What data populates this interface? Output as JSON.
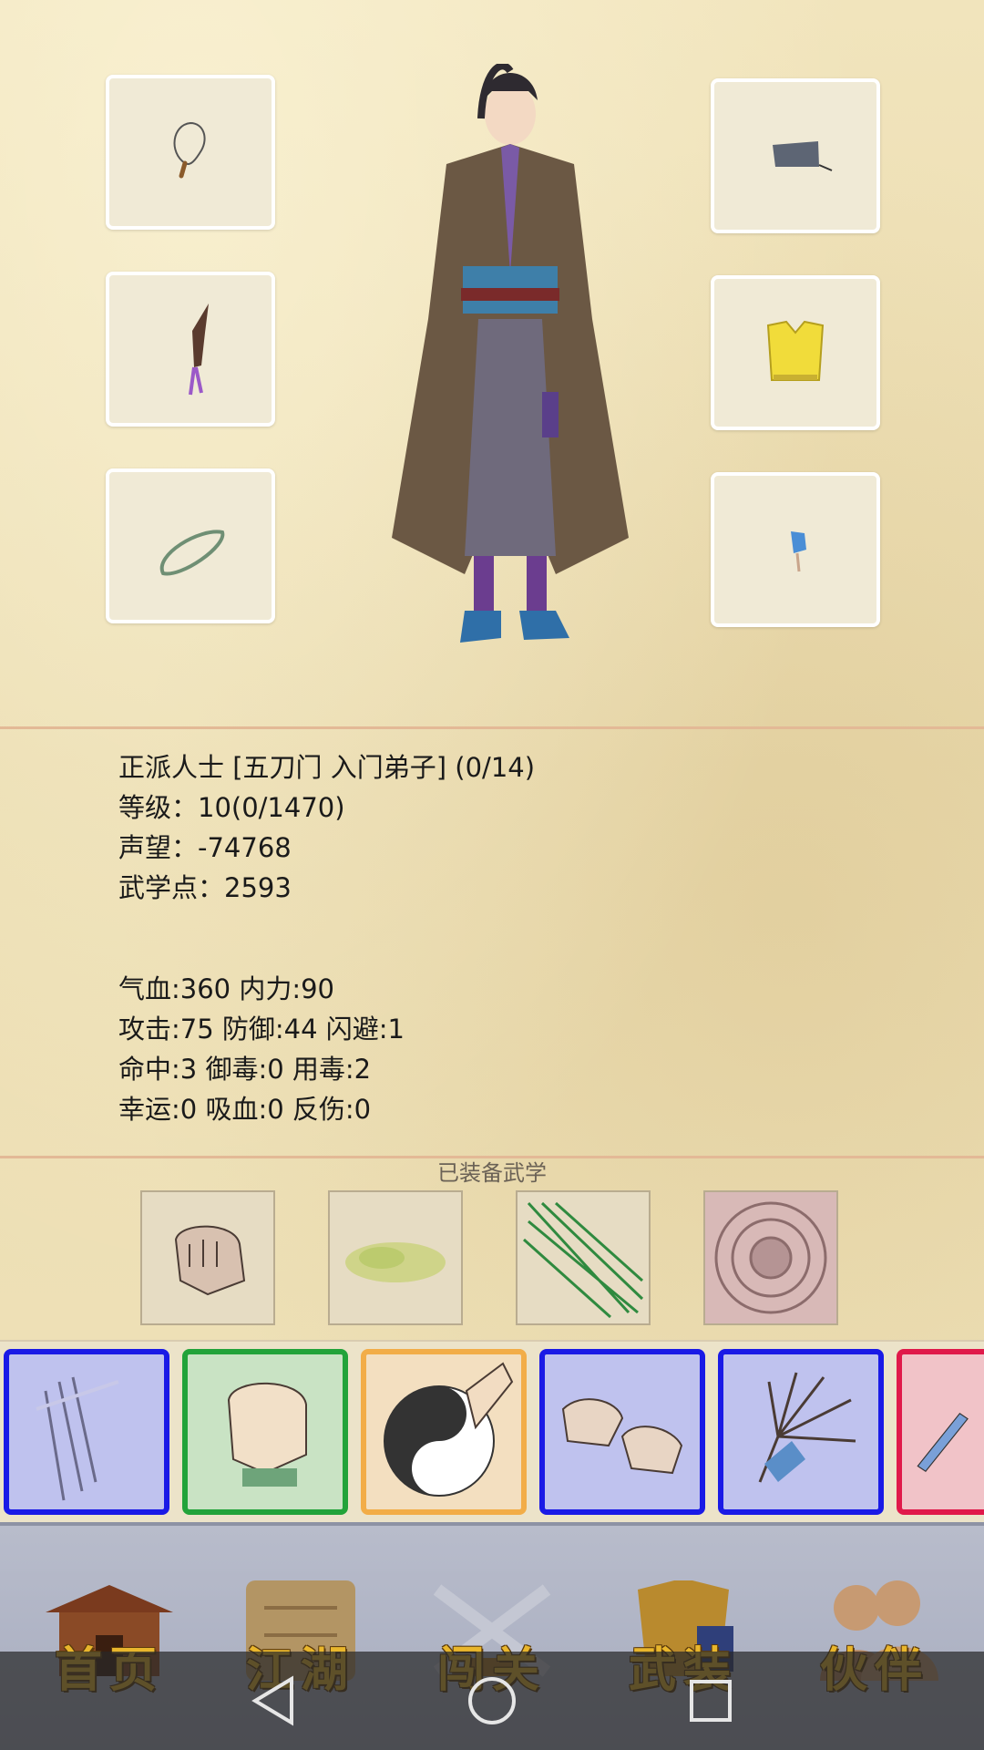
{
  "equipment": {
    "left_slots": [
      {
        "item": "beads-necklace-icon"
      },
      {
        "item": "dagger-icon"
      },
      {
        "item": "jade-ring-icon"
      }
    ],
    "right_slots": [
      {
        "item": "cloth-cap-icon"
      },
      {
        "item": "yellow-vest-icon"
      },
      {
        "item": "blue-pendant-icon"
      }
    ]
  },
  "profile": {
    "title_line": "正派人士 [五刀门 入门弟子] (0/14)",
    "level": "等级：10(0/1470)",
    "reputation": "声望：-74768",
    "martial_points": "武学点：2593"
  },
  "stats": {
    "line1": "气血:360  内力:90",
    "line2": "攻击:75  防御:44  闪避:1",
    "line3": "命中:3  御毒:0  用毒:2",
    "line4": "幸运:0  吸血:0  反伤:0"
  },
  "equipped_martial": {
    "label": "已装备武学",
    "skills": [
      "fist-skill-icon",
      "green-mist-skill-icon",
      "needle-skill-icon",
      "seal-skill-icon"
    ]
  },
  "skill_tray": [
    {
      "icon": "sword-slash-icon",
      "border": "#1a1ae6",
      "bg": "#bfc2ee"
    },
    {
      "icon": "fist-icon",
      "border": "#22a33a",
      "bg": "#c9e3c4"
    },
    {
      "icon": "taiji-palm-icon",
      "border": "#f2ad48",
      "bg": "#f3dfc0"
    },
    {
      "icon": "twin-fist-icon",
      "border": "#1a1ae6",
      "bg": "#bfc2ee"
    },
    {
      "icon": "claw-hand-icon",
      "border": "#1a1ae6",
      "bg": "#bfc2ee"
    },
    {
      "icon": "blade-icon",
      "border": "#e0194a",
      "bg": "#f1c3c8"
    }
  ],
  "nav": [
    {
      "label": "首页",
      "icon": "house-icon"
    },
    {
      "label": "江湖",
      "icon": "scroll-map-icon"
    },
    {
      "label": "闯关",
      "icon": "crossed-swords-icon"
    },
    {
      "label": "武装",
      "icon": "armor-icon"
    },
    {
      "label": "伙伴",
      "icon": "companions-icon"
    }
  ],
  "colors": {
    "divider": "#e3b996",
    "nav_text": "#e9b62c"
  }
}
